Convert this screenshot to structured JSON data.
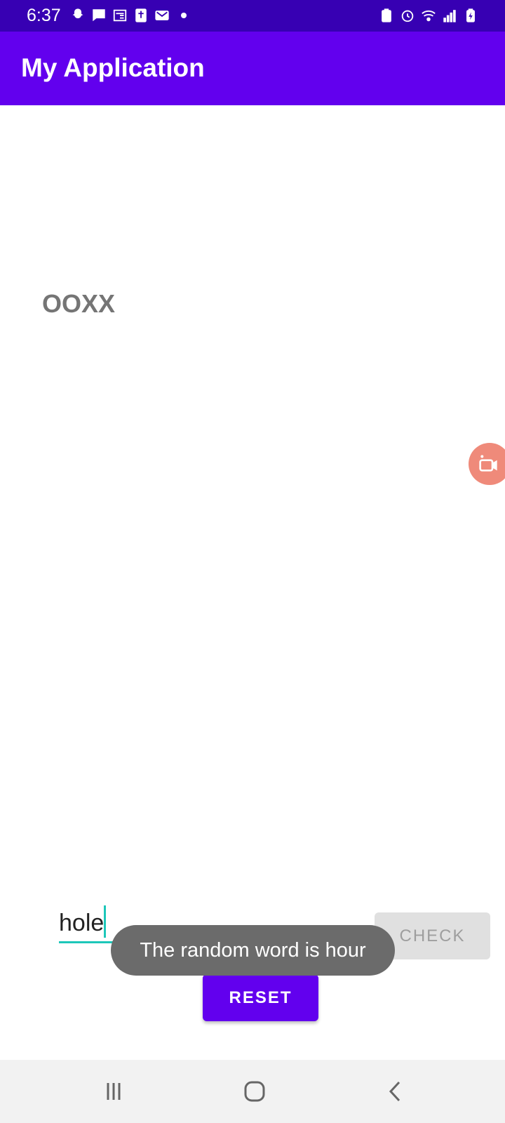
{
  "status_bar": {
    "time": "6:37",
    "left_icons": [
      "snapchat-icon",
      "chat-icon",
      "news-icon",
      "bible-icon",
      "outlook-icon",
      "notification-dot"
    ],
    "right_icons": [
      "battery-saver-icon",
      "alarm-icon",
      "wifi-icon",
      "signal-icon",
      "battery-charging-icon"
    ]
  },
  "app_bar": {
    "title": "My Application"
  },
  "game": {
    "masked_word": "OOXX",
    "input_value": "hole",
    "check_label": "CHECK",
    "reset_label": "RESET"
  },
  "toast": {
    "message": "The random word is hour"
  },
  "colors": {
    "status_bar": "#3700b3",
    "primary": "#6200ee",
    "accent": "#1dc7b9",
    "toast_bg": "#6b6b6b",
    "disabled_button": "#e0e0e0"
  },
  "nav_bar": {
    "buttons": [
      "recent-apps-icon",
      "home-icon",
      "back-icon"
    ]
  }
}
